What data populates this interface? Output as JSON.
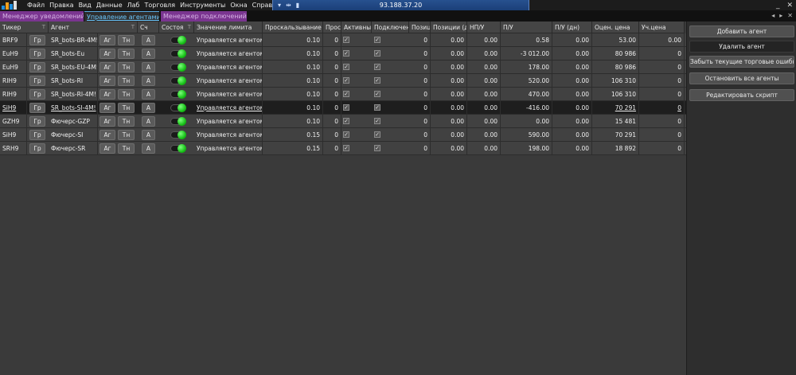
{
  "menu": {
    "items": [
      "Файл",
      "Правка",
      "Вид",
      "Данные",
      "Лаб",
      "Торговля",
      "Инструменты",
      "Окна",
      "Справка"
    ],
    "server_address": "93.188.37.20"
  },
  "tabs": [
    {
      "label": "Менеджер уведомлений",
      "active": false
    },
    {
      "label": "Управление агентами",
      "active": true
    },
    {
      "label": "Менеджер подключений",
      "active": false
    }
  ],
  "columns": {
    "ticker": "Тикер",
    "agent": "Агент",
    "counter": "Сч",
    "state": "Состоя",
    "limit_value": "Значение лимита",
    "slippage": "Проскальзывание %",
    "pros": "Прос",
    "active": "Активный",
    "connected": "Подключен",
    "position": "Позиц",
    "positions_day": "Позиции (д",
    "np_u": "НП/У",
    "pu": "П/У",
    "pu_day": "П/У (дн)",
    "est_price": "Оцен. цена",
    "acc_price": "Уч.цена",
    "filter_glyph": "T"
  },
  "row_buttons": {
    "gr": "Гр",
    "ag": "Аг",
    "tn": "Тн",
    "a": "A"
  },
  "rows": [
    {
      "ticker": "BRF9",
      "agent": "SR_bots-BR-4M!",
      "limit": "Управляется агентом",
      "slippage": "0.10",
      "pros": "0",
      "position": "0",
      "positions_day": "0.00",
      "np_u": "0.00",
      "pu": "0.58",
      "pu_day": "0.00",
      "est_price": "53.00",
      "acc_price": "0.00"
    },
    {
      "ticker": "EuH9",
      "agent": "SR_bots-Eu",
      "limit": "Управляется агентом",
      "slippage": "0.10",
      "pros": "0",
      "position": "0",
      "positions_day": "0.00",
      "np_u": "0.00",
      "pu": "-3 012.00",
      "pu_day": "0.00",
      "est_price": "80 986",
      "acc_price": "0"
    },
    {
      "ticker": "EuH9",
      "agent": "SR_bots-EU-4M!",
      "limit": "Управляется агентом",
      "slippage": "0.10",
      "pros": "0",
      "position": "0",
      "positions_day": "0.00",
      "np_u": "0.00",
      "pu": "178.00",
      "pu_day": "0.00",
      "est_price": "80 986",
      "acc_price": "0"
    },
    {
      "ticker": "RIH9",
      "agent": "SR_bots-RI",
      "limit": "Управляется агентом",
      "slippage": "0.10",
      "pros": "0",
      "position": "0",
      "positions_day": "0.00",
      "np_u": "0.00",
      "pu": "520.00",
      "pu_day": "0.00",
      "est_price": "106 310",
      "acc_price": "0"
    },
    {
      "ticker": "RIH9",
      "agent": "SR_bots-RI-4M!",
      "limit": "Управляется агентом",
      "slippage": "0.10",
      "pros": "0",
      "position": "0",
      "positions_day": "0.00",
      "np_u": "0.00",
      "pu": "470.00",
      "pu_day": "0.00",
      "est_price": "106 310",
      "acc_price": "0"
    },
    {
      "ticker": "SiH9",
      "agent": "SR_bots-SI-4M!",
      "limit": "Управляется агентом",
      "slippage": "0.10",
      "pros": "0",
      "position": "0",
      "positions_day": "0.00",
      "np_u": "0.00",
      "pu": "-416.00",
      "pu_day": "0.00",
      "est_price": "70 291",
      "acc_price": "0",
      "selected": true
    },
    {
      "ticker": "GZH9",
      "agent": "Фючерс-GZP",
      "limit": "Управляется агентом",
      "slippage": "0.10",
      "pros": "0",
      "position": "0",
      "positions_day": "0.00",
      "np_u": "0.00",
      "pu": "0.00",
      "pu_day": "0.00",
      "est_price": "15 481",
      "acc_price": "0"
    },
    {
      "ticker": "SiH9",
      "agent": "Фючерс-SI",
      "limit": "Управляется агентом",
      "slippage": "0.15",
      "pros": "0",
      "position": "0",
      "positions_day": "0.00",
      "np_u": "0.00",
      "pu": "590.00",
      "pu_day": "0.00",
      "est_price": "70 291",
      "acc_price": "0"
    },
    {
      "ticker": "SRH9",
      "agent": "Фючерс-SR",
      "limit": "Управляется агентом",
      "slippage": "0.15",
      "pros": "0",
      "position": "0",
      "positions_day": "0.00",
      "np_u": "0.00",
      "pu": "198.00",
      "pu_day": "0.00",
      "est_price": "18 892",
      "acc_price": "0"
    }
  ],
  "right_panel": {
    "add_agent": "Добавить агент",
    "delete_agent": "Удалить агент",
    "forget_errors": "Забыть текущие торговые  ошибки",
    "stop_all": "Остановить все агенты",
    "edit_script": "Редактировать скрипт"
  }
}
